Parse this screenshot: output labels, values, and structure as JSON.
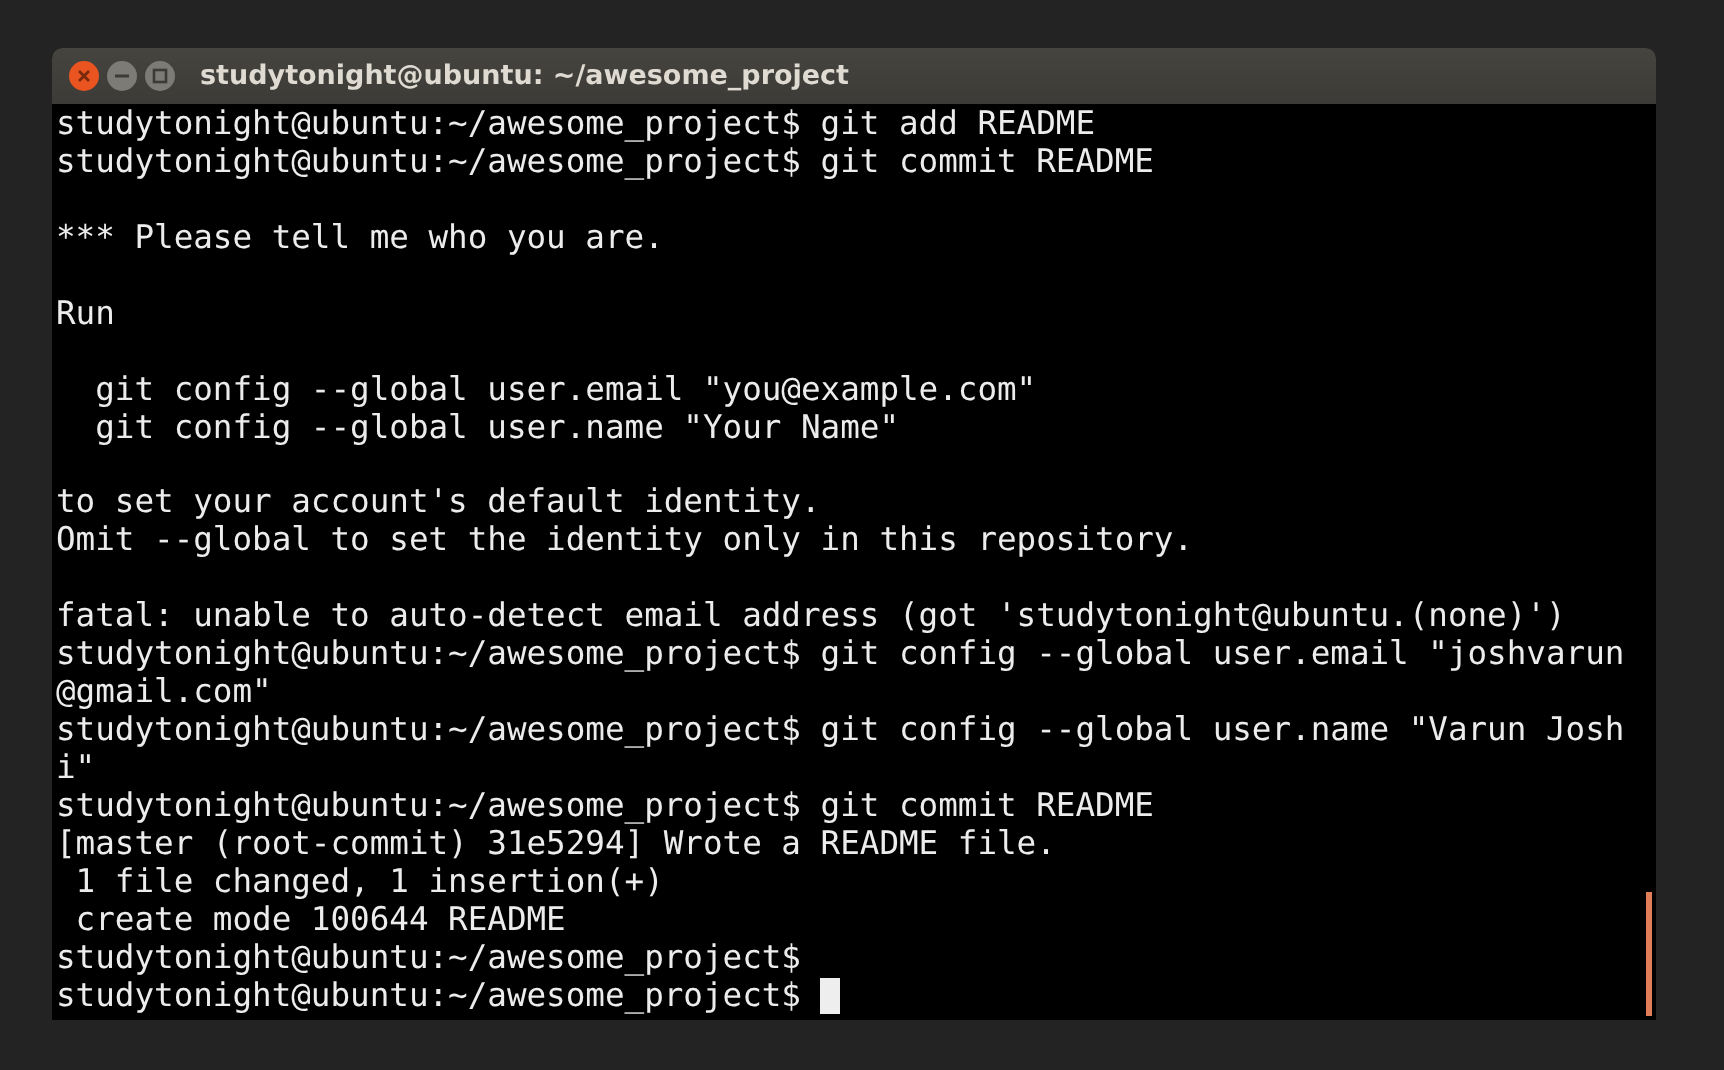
{
  "window": {
    "title": "studytonight@ubuntu: ~/awesome_project"
  },
  "terminal": {
    "lines": [
      {
        "kind": "text",
        "text": "studytonight@ubuntu:~/awesome_project$ git add README"
      },
      {
        "kind": "text",
        "text": "studytonight@ubuntu:~/awesome_project$ git commit README"
      },
      {
        "kind": "blank"
      },
      {
        "kind": "text",
        "text": "*** Please tell me who you are."
      },
      {
        "kind": "blank"
      },
      {
        "kind": "text",
        "text": "Run"
      },
      {
        "kind": "blank"
      },
      {
        "kind": "text",
        "text": "  git config --global user.email \"you@example.com\""
      },
      {
        "kind": "text",
        "text": "  git config --global user.name \"Your Name\""
      },
      {
        "kind": "blank"
      },
      {
        "kind": "text",
        "text": "to set your account's default identity."
      },
      {
        "kind": "text",
        "text": "Omit --global to set the identity only in this repository."
      },
      {
        "kind": "blank"
      },
      {
        "kind": "text",
        "text": "fatal: unable to auto-detect email address (got 'studytonight@ubuntu.(none)')"
      },
      {
        "kind": "text",
        "text": "studytonight@ubuntu:~/awesome_project$ git config --global user.email \"joshvarun"
      },
      {
        "kind": "text",
        "text": "@gmail.com\""
      },
      {
        "kind": "text",
        "text": "studytonight@ubuntu:~/awesome_project$ git config --global user.name \"Varun Josh"
      },
      {
        "kind": "text",
        "text": "i\""
      },
      {
        "kind": "text",
        "text": "studytonight@ubuntu:~/awesome_project$ git commit README"
      },
      {
        "kind": "text",
        "text": "[master (root-commit) 31e5294] Wrote a README file."
      },
      {
        "kind": "text",
        "text": " 1 file changed, 1 insertion(+)"
      },
      {
        "kind": "text",
        "text": " create mode 100644 README"
      },
      {
        "kind": "text",
        "text": "studytonight@ubuntu:~/awesome_project$"
      },
      {
        "kind": "prompt",
        "text": "studytonight@ubuntu:~/awesome_project$ "
      }
    ]
  }
}
